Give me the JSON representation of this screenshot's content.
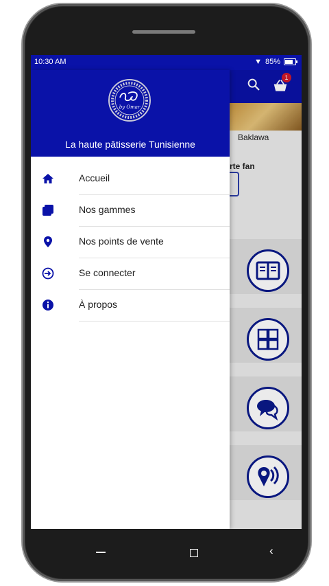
{
  "status_bar": {
    "time": "10:30 AM",
    "battery": "85%"
  },
  "background": {
    "product_label": "Baklawa",
    "section_label": "rte fan",
    "cart_count": "1"
  },
  "drawer": {
    "subtitle": "La haute pâtisserie Tunisienne",
    "logo_text": "by Omar",
    "items": [
      {
        "label": "Accueil",
        "icon": "home-icon"
      },
      {
        "label": "Nos gammes",
        "icon": "layers-icon"
      },
      {
        "label": "Nos points de vente",
        "icon": "map-pin-icon"
      },
      {
        "label": "Se connecter",
        "icon": "login-icon"
      },
      {
        "label": "À propos",
        "icon": "info-icon"
      }
    ]
  },
  "colors": {
    "primary": "#0a12a8",
    "accent_red": "#d11a2a",
    "icon_navy": "#0a1a8a"
  }
}
